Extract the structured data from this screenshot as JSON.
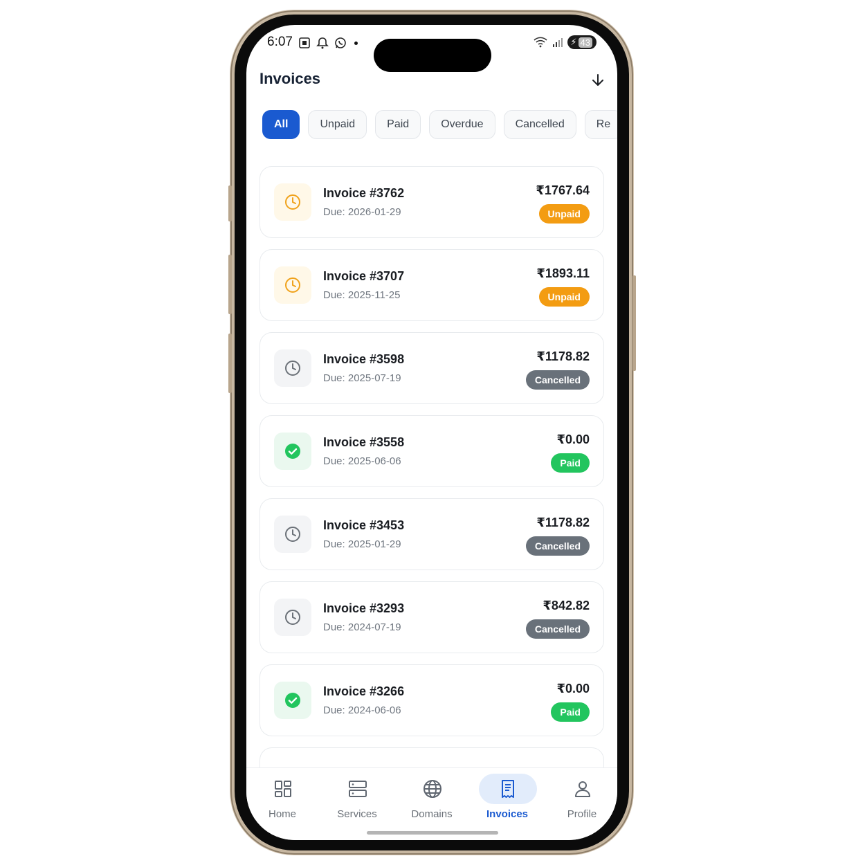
{
  "status_bar": {
    "time": "6:07",
    "battery": "43"
  },
  "header": {
    "title": "Invoices",
    "download_icon": "arrow-down-icon"
  },
  "filters": [
    {
      "label": "All",
      "active": true
    },
    {
      "label": "Unpaid",
      "active": false
    },
    {
      "label": "Paid",
      "active": false
    },
    {
      "label": "Overdue",
      "active": false
    },
    {
      "label": "Cancelled",
      "active": false
    },
    {
      "label": "Re",
      "active": false
    }
  ],
  "invoices": [
    {
      "title": "Invoice #3762",
      "due": "Due: 2026-01-29",
      "amount": "₹1767.64",
      "status": "Unpaid"
    },
    {
      "title": "Invoice #3707",
      "due": "Due: 2025-11-25",
      "amount": "₹1893.11",
      "status": "Unpaid"
    },
    {
      "title": "Invoice #3598",
      "due": "Due: 2025-07-19",
      "amount": "₹1178.82",
      "status": "Cancelled"
    },
    {
      "title": "Invoice #3558",
      "due": "Due: 2025-06-06",
      "amount": "₹0.00",
      "status": "Paid"
    },
    {
      "title": "Invoice #3453",
      "due": "Due: 2025-01-29",
      "amount": "₹1178.82",
      "status": "Cancelled"
    },
    {
      "title": "Invoice #3293",
      "due": "Due: 2024-07-19",
      "amount": "₹842.82",
      "status": "Cancelled"
    },
    {
      "title": "Invoice #3266",
      "due": "Due: 2024-06-06",
      "amount": "₹0.00",
      "status": "Paid"
    }
  ],
  "nav": {
    "home": "Home",
    "services": "Services",
    "domains": "Domains",
    "invoices": "Invoices",
    "profile": "Profile",
    "active": "Invoices"
  },
  "colors": {
    "accent": "#1a5ad0",
    "unpaid": "#f39c12",
    "cancelled": "#69717a",
    "paid": "#22c55e"
  }
}
